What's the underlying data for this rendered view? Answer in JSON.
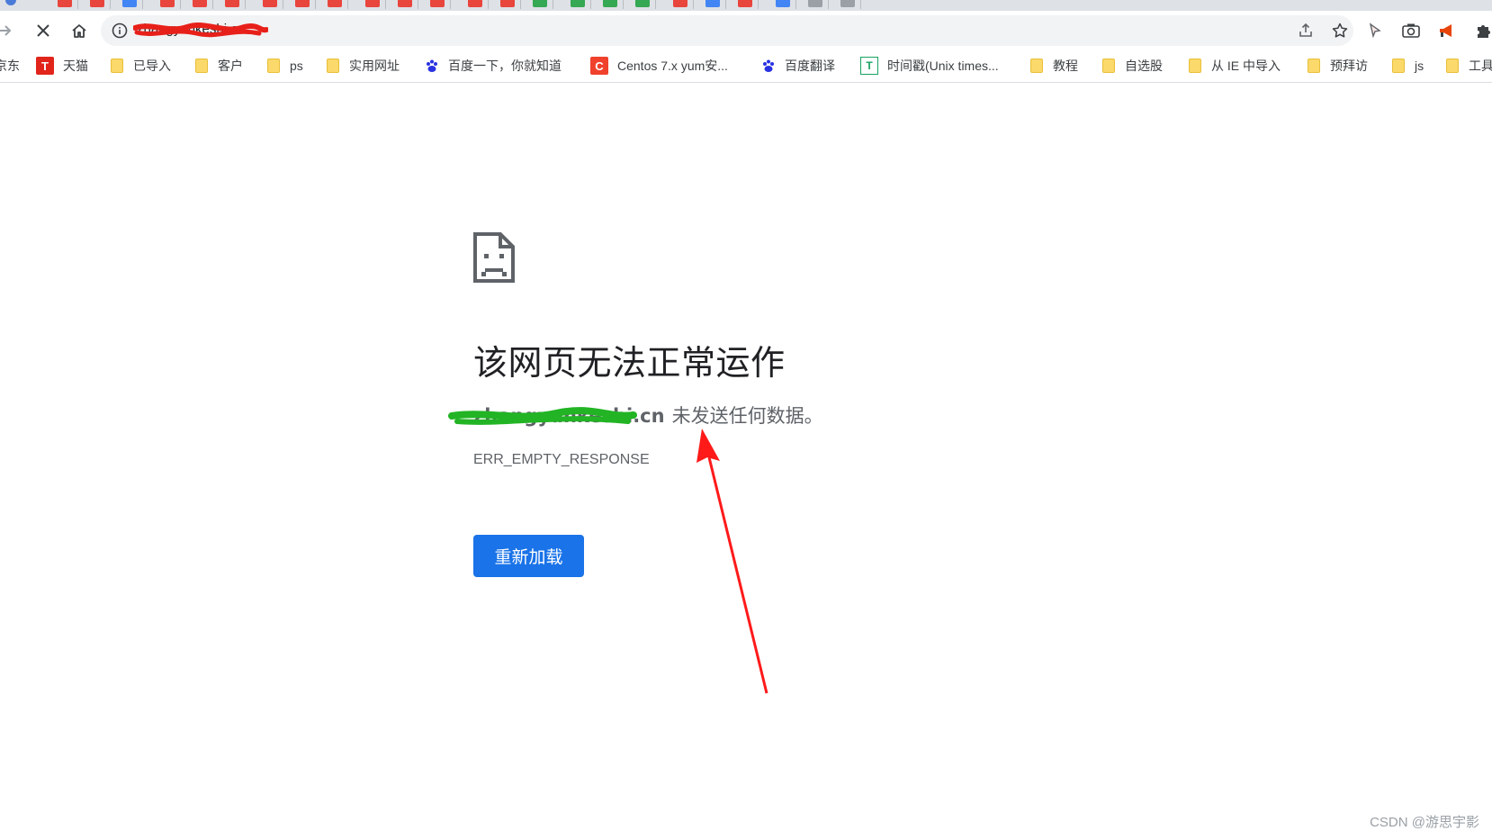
{
  "browser": {
    "address_bar": {
      "url": "zhangyunkeshi.cn"
    },
    "bookmarks": [
      {
        "label": "京东",
        "icon": "jd-favicon"
      },
      {
        "label": "天猫",
        "icon": "tmall-favicon"
      },
      {
        "label": "已导入",
        "icon": "folder-icon"
      },
      {
        "label": "客户",
        "icon": "folder-icon"
      },
      {
        "label": "ps",
        "icon": "folder-icon"
      },
      {
        "label": "实用网址",
        "icon": "folder-icon"
      },
      {
        "label": "百度一下，你就知道",
        "icon": "baidu-favicon"
      },
      {
        "label": "Centos 7.x yum安...",
        "icon": "csdn-favicon"
      },
      {
        "label": "百度翻译",
        "icon": "baidu-favicon"
      },
      {
        "label": "时间戳(Unix times...",
        "icon": "timestamp-favicon"
      },
      {
        "label": "教程",
        "icon": "folder-icon"
      },
      {
        "label": "自选股",
        "icon": "folder-icon"
      },
      {
        "label": "从 IE 中导入",
        "icon": "folder-icon"
      },
      {
        "label": "预拜访",
        "icon": "folder-icon"
      },
      {
        "label": "js",
        "icon": "folder-icon"
      },
      {
        "label": "工具",
        "icon": "folder-icon"
      }
    ]
  },
  "error_page": {
    "heading": "该网页无法正常运作",
    "host": "zhangyunkeshi.cn",
    "message": "未发送任何数据。",
    "error_code": "ERR_EMPTY_RESPONSE",
    "reload_label": "重新加载"
  },
  "watermark": "CSDN @游思宇影",
  "colors": {
    "reload_button": "#1a73e8",
    "annotation_arrow": "#ff1a1a",
    "redaction_red": "#e8201a",
    "redaction_green": "#22b424"
  }
}
